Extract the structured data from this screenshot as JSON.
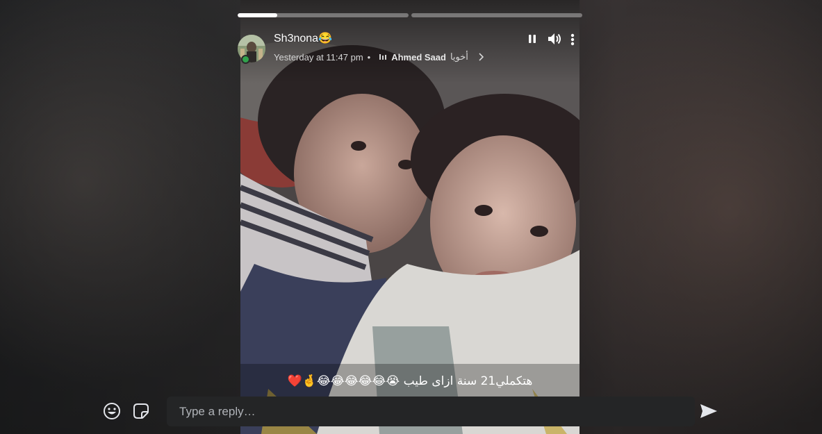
{
  "story": {
    "progress_segments": [
      {
        "fraction": 0.23
      },
      {
        "fraction": 0.0
      }
    ],
    "author": {
      "name": "Sh3nona😂",
      "online": true,
      "avatar_icon": "profile-photo"
    },
    "meta": {
      "time": "Yesterday at 11:47 pm",
      "separator": "•",
      "music_icon": "music-bars-icon",
      "music_artist": "Ahmed Saad",
      "music_title": "أخويا",
      "chevron_icon": "chevron-right-icon"
    },
    "controls": {
      "pause_icon": "pause-icon",
      "volume_icon": "volume-icon",
      "more_icon": "more-vertical-icon"
    },
    "caption": "هتكملي21 سنة ازاى طيب 😭😂😂😂😂😂🤞❤️"
  },
  "reply": {
    "emoji_icon": "emoji-icon",
    "sticker_icon": "sticker-icon",
    "placeholder": "Type a reply…",
    "value": "",
    "send_icon": "send-icon"
  },
  "colors": {
    "progress_fill": "#ffffff",
    "progress_track": "rgba(255,255,255,0.35)",
    "online": "#31a24c",
    "reply_bg": "#242526"
  }
}
